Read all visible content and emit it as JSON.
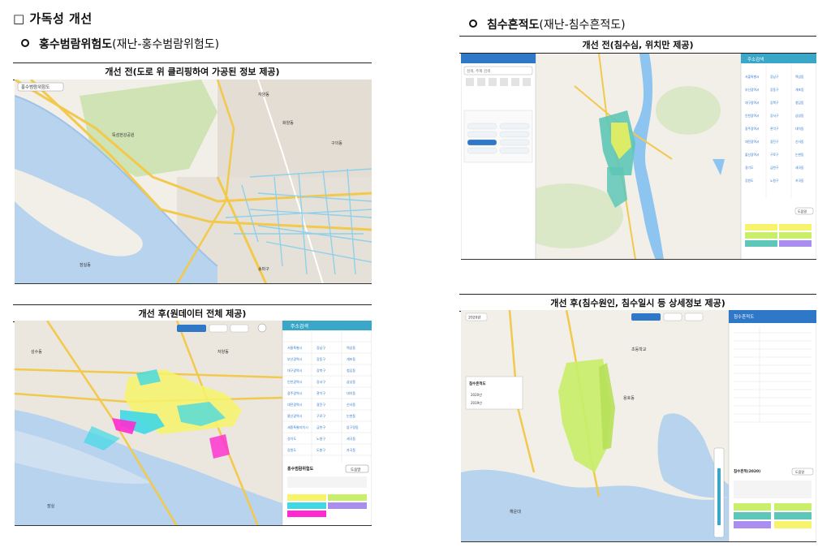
{
  "heading": "□ 가독성 개선",
  "sections": {
    "flood": {
      "name": "홍수범람위험도",
      "source": "(재난-홍수범람위험도)"
    },
    "inundation": {
      "name": "침수흔적도",
      "source": "(재난-침수흔적도)"
    }
  },
  "captions": {
    "flood_before": "개선 전(도로 위 클리핑하여 가공된 정보 제공)",
    "flood_after": "개선 후(원데이터 전체 제공)",
    "inund_before": "개선 전(침수심, 위치만 제공)",
    "inund_after": "개선 후(침수원인, 침수일시 등 상세정보 제공)"
  },
  "map_ui": {
    "layer_tag": "홍수범람위험도",
    "address_panel_title": "주소검색",
    "inund_panel_title": "침수흔적도",
    "legend_title": "홍수범람위험도",
    "legend_title2": "침수흔적(2020)",
    "legend_button": "도움말",
    "search_placeholder": "검색, 주제 검색",
    "year_2020": "2020년",
    "year_prev": "2019년"
  },
  "colors": {
    "water": "#b7d3ee",
    "land": "#f3f1ea",
    "road": "#f2c94c",
    "park": "#cfe3b5",
    "urban": "#dcd7ce",
    "flood_cyan": "#40d8e6",
    "flood_yellow": "#f7f36b",
    "flood_magenta": "#ff2bd0",
    "inund_green": "#c9ee6a",
    "inund_teal": "#5ec7b7",
    "panel_blue": "#2f78c8"
  }
}
